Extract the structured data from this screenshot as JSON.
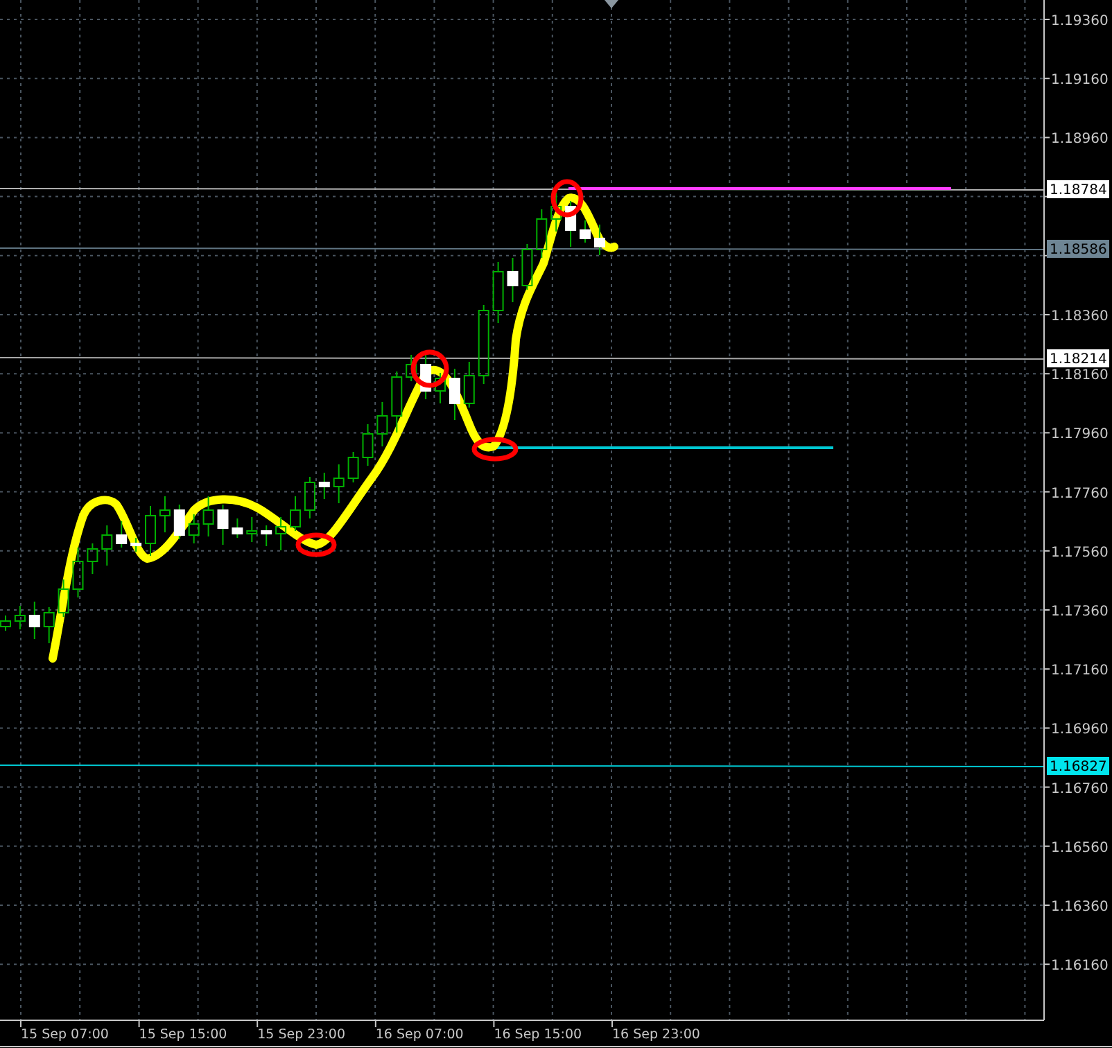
{
  "price_axis": {
    "labels": [
      "1.19360",
      "1.19160",
      "1.18960",
      "1.18360",
      "1.18160",
      "1.17960",
      "1.17760",
      "1.17560",
      "1.17360",
      "1.17160",
      "1.16960",
      "1.16760",
      "1.16560",
      "1.16360",
      "1.16160"
    ]
  },
  "time_axis": {
    "labels": [
      "15 Sep 07:00",
      "15 Sep 15:00",
      "15 Sep 23:00",
      "16 Sep 07:00",
      "16 Sep 15:00",
      "16 Sep 23:00"
    ]
  },
  "price_levels": [
    {
      "label": "1.18784",
      "color": "#ffffff"
    },
    {
      "label": "1.18586",
      "color": "#6e8594"
    },
    {
      "label": "1.18214",
      "color": "#ffffff"
    },
    {
      "label": "1.16827",
      "color": "#00e5ee"
    }
  ]
}
